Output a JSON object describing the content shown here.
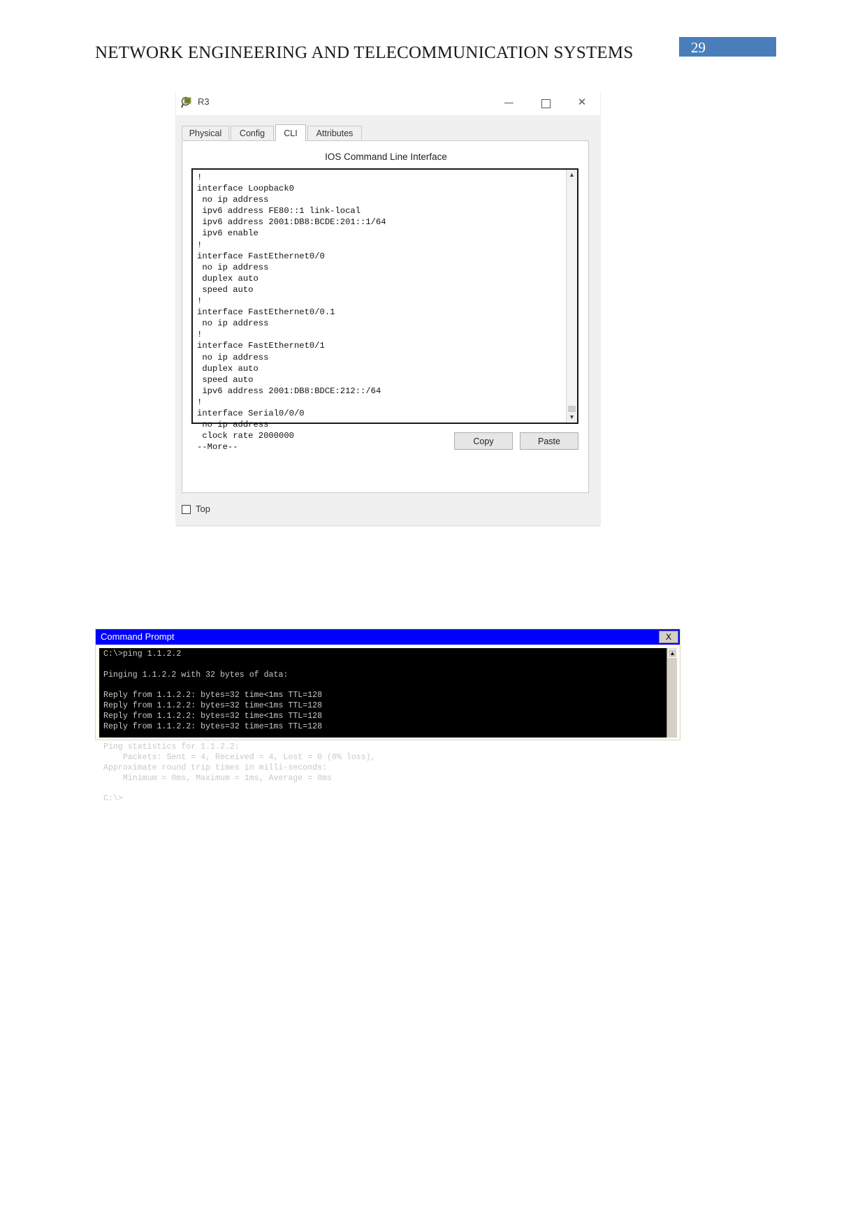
{
  "document": {
    "header_title": "NETWORK ENGINEERING AND TELECOMMUNICATION SYSTEMS",
    "page_number": "29",
    "badge_color": "#4a7ebb"
  },
  "device_window": {
    "title": "R3",
    "icon": "router-device-icon",
    "minimize_label": "—",
    "maximize_label": "□",
    "close_label": "✕",
    "tabs": [
      {
        "label": "Physical",
        "active": false
      },
      {
        "label": "Config",
        "active": false
      },
      {
        "label": "CLI",
        "active": true
      },
      {
        "label": "Attributes",
        "active": false
      }
    ],
    "cli": {
      "heading": "IOS Command Line Interface",
      "output": "!\ninterface Loopback0\n no ip address\n ipv6 address FE80::1 link-local\n ipv6 address 2001:DB8:BCDE:201::1/64\n ipv6 enable\n!\ninterface FastEthernet0/0\n no ip address\n duplex auto\n speed auto\n!\ninterface FastEthernet0/0.1\n no ip address\n!\ninterface FastEthernet0/1\n no ip address\n duplex auto\n speed auto\n ipv6 address 2001:DB8:BDCE:212::/64\n!\ninterface Serial0/0/0\n no ip address\n clock rate 2000000\n--More--",
      "scroll_up_glyph": "▲",
      "scroll_down_glyph": "▼"
    },
    "buttons": {
      "copy_label": "Copy",
      "paste_label": "Paste"
    },
    "top_checkbox": {
      "label": "Top",
      "checked": false
    }
  },
  "command_prompt": {
    "title": "Command Prompt",
    "close_label": "X",
    "titlebar_color": "#0000ff",
    "scroll_up_glyph": "▲",
    "output": "C:\\>ping 1.1.2.2\n\nPinging 1.1.2.2 with 32 bytes of data:\n\nReply from 1.1.2.2: bytes=32 time<1ms TTL=128\nReply from 1.1.2.2: bytes=32 time<1ms TTL=128\nReply from 1.1.2.2: bytes=32 time<1ms TTL=128\nReply from 1.1.2.2: bytes=32 time=1ms TTL=128\n\nPing statistics for 1.1.2.2:\n    Packets: Sent = 4, Received = 4, Lost = 0 (0% loss),\nApproximate round trip times in milli-seconds:\n    Minimum = 0ms, Maximum = 1ms, Average = 0ms\n\nC:\\>"
  }
}
